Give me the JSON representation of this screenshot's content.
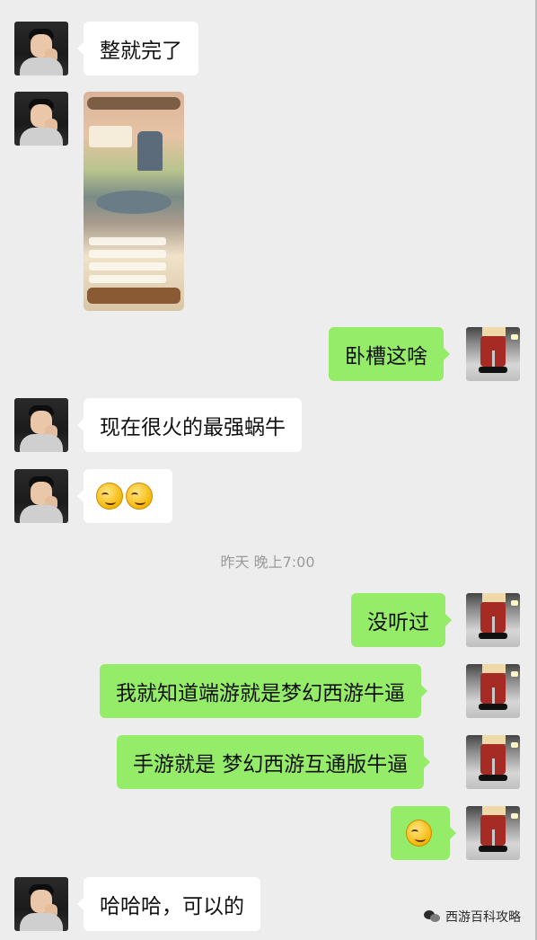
{
  "chat": {
    "messages": [
      {
        "sender": "friend",
        "type": "text",
        "text": "整就完了"
      },
      {
        "sender": "friend",
        "type": "image",
        "image_alt": "game screenshot"
      },
      {
        "sender": "me",
        "type": "text",
        "text": "卧槽这啥"
      },
      {
        "sender": "friend",
        "type": "text",
        "text": "现在很火的最强蜗牛"
      },
      {
        "sender": "friend",
        "type": "emoji",
        "emojis": [
          "smirk-emoji",
          "smirk-emoji"
        ]
      },
      {
        "sender": "me",
        "type": "text",
        "text": "没听过"
      },
      {
        "sender": "me",
        "type": "text",
        "text": "我就知道端游就是梦幻西游牛逼"
      },
      {
        "sender": "me",
        "type": "text",
        "text": "手游就是 梦幻西游互通版牛逼"
      },
      {
        "sender": "me",
        "type": "emoji",
        "emojis": [
          "smirk-emoji"
        ]
      },
      {
        "sender": "friend",
        "type": "text",
        "text": "哈哈哈，可以的"
      }
    ],
    "timestamp": "昨天 晚上7:00"
  },
  "watermark": {
    "text": "西游百科攻略",
    "icon": "wechat-icon"
  },
  "colors": {
    "background": "#ededed",
    "incoming_bubble": "#ffffff",
    "outgoing_bubble": "#95ec69",
    "timestamp_text": "#9b9b9b"
  }
}
